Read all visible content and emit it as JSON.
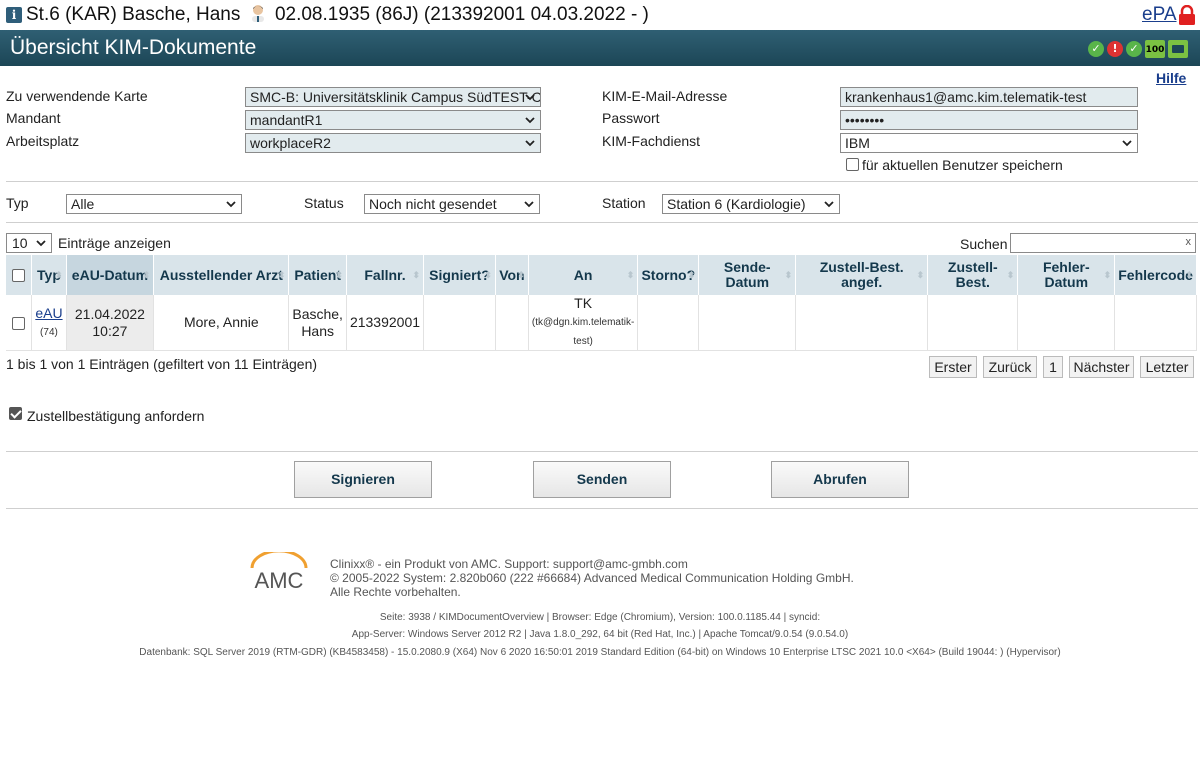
{
  "patient": {
    "prefix": "St.6 (KAR) Basche, Hans",
    "suffix": "02.08.1935 (86J) (213392001 04.03.2022 - )",
    "epa_label": "ePA"
  },
  "header": {
    "title": "Übersicht KIM-Dokumente",
    "badge_text": "100"
  },
  "help_label": "Hilfe",
  "form": {
    "card_label": "Zu verwendende Karte",
    "card_value": "SMC-B: Universitätsklinik Campus SüdTEST-C",
    "mandant_label": "Mandant",
    "mandant_value": "mandantR1",
    "workplace_label": "Arbeitsplatz",
    "workplace_value": "workplaceR2",
    "email_label": "KIM-E-Mail-Adresse",
    "email_value": "krankenhaus1@amc.kim.telematik-test",
    "password_label": "Passwort",
    "password_value": "••••••••",
    "service_label": "KIM-Fachdienst",
    "service_value": "IBM",
    "save_user_label": "für aktuellen Benutzer speichern"
  },
  "filters": {
    "type_label": "Typ",
    "type_value": "Alle",
    "status_label": "Status",
    "status_value": "Noch nicht gesendet",
    "station_label": "Station",
    "station_value": "Station 6 (Kardiologie)"
  },
  "list": {
    "page_size": "10",
    "page_size_label": "Einträge anzeigen",
    "search_label": "Suchen",
    "search_clear": "x",
    "columns": [
      "Typ",
      "eAU-Datum",
      "Ausstellender Arzt",
      "Patient",
      "Fallnr.",
      "Signiert?",
      "Von",
      "An",
      "Storno?",
      "Sende-Datum",
      "Zustell-Best. angef.",
      "Zustell-Best.",
      "Fehler-Datum",
      "Fehlercode"
    ],
    "rows": [
      {
        "typ": "eAU",
        "typ_count": "(74)",
        "date": "21.04.2022",
        "time": "10:27",
        "doctor": "More, Annie",
        "patient_line1": "Basche,",
        "patient_line2": "Hans",
        "case_no": "213392001",
        "signed": "",
        "from": "",
        "to": "TK",
        "to_detail": "(tk@dgn.kim.telematik-test)",
        "storno": "",
        "send_date": "",
        "ack_requested": "",
        "ack": "",
        "error_date": "",
        "error_code": ""
      }
    ],
    "info": "1 bis 1 von 1 Einträgen (gefiltert von 11 Einträgen)",
    "pager": {
      "first": "Erster",
      "prev": "Zurück",
      "page": "1",
      "next": "Nächster",
      "last": "Letzter"
    }
  },
  "delivery_ack_label": "Zustellbestätigung anfordern",
  "actions": {
    "sign": "Signieren",
    "send": "Senden",
    "fetch": "Abrufen"
  },
  "footer": {
    "logo_text": "AMC",
    "line1": "Clinixx® - ein Produkt von AMC. Support: support@amc-gmbh.com",
    "line2": "© 2005-2022 System: 2.820b060 (222 #66684) Advanced Medical Communication Holding GmbH.",
    "line3": "Alle Rechte vorbehalten.",
    "info1": "Seite: 3938 / KIMDocumentOverview | Browser: Edge (Chromium), Version: 100.0.1185.44 | syncid:",
    "info2": "App-Server: Windows Server 2012 R2 | Java 1.8.0_292, 64 bit (Red Hat, Inc.) | Apache Tomcat/9.0.54 (9.0.54.0)",
    "info3": "Datenbank: SQL Server 2019 (RTM-GDR) (KB4583458) - 15.0.2080.9 (X64) Nov 6 2020 16:50:01 2019 Standard Edition (64-bit) on Windows 10 Enterprise LTSC 2021 10.0 <X64> (Build 19044: ) (Hypervisor)"
  },
  "colors": {
    "header": "#1c4656",
    "link": "#1a3e8c",
    "ok": "#59b54a",
    "alert": "#dd3333",
    "logo_orange": "#f0a030"
  }
}
